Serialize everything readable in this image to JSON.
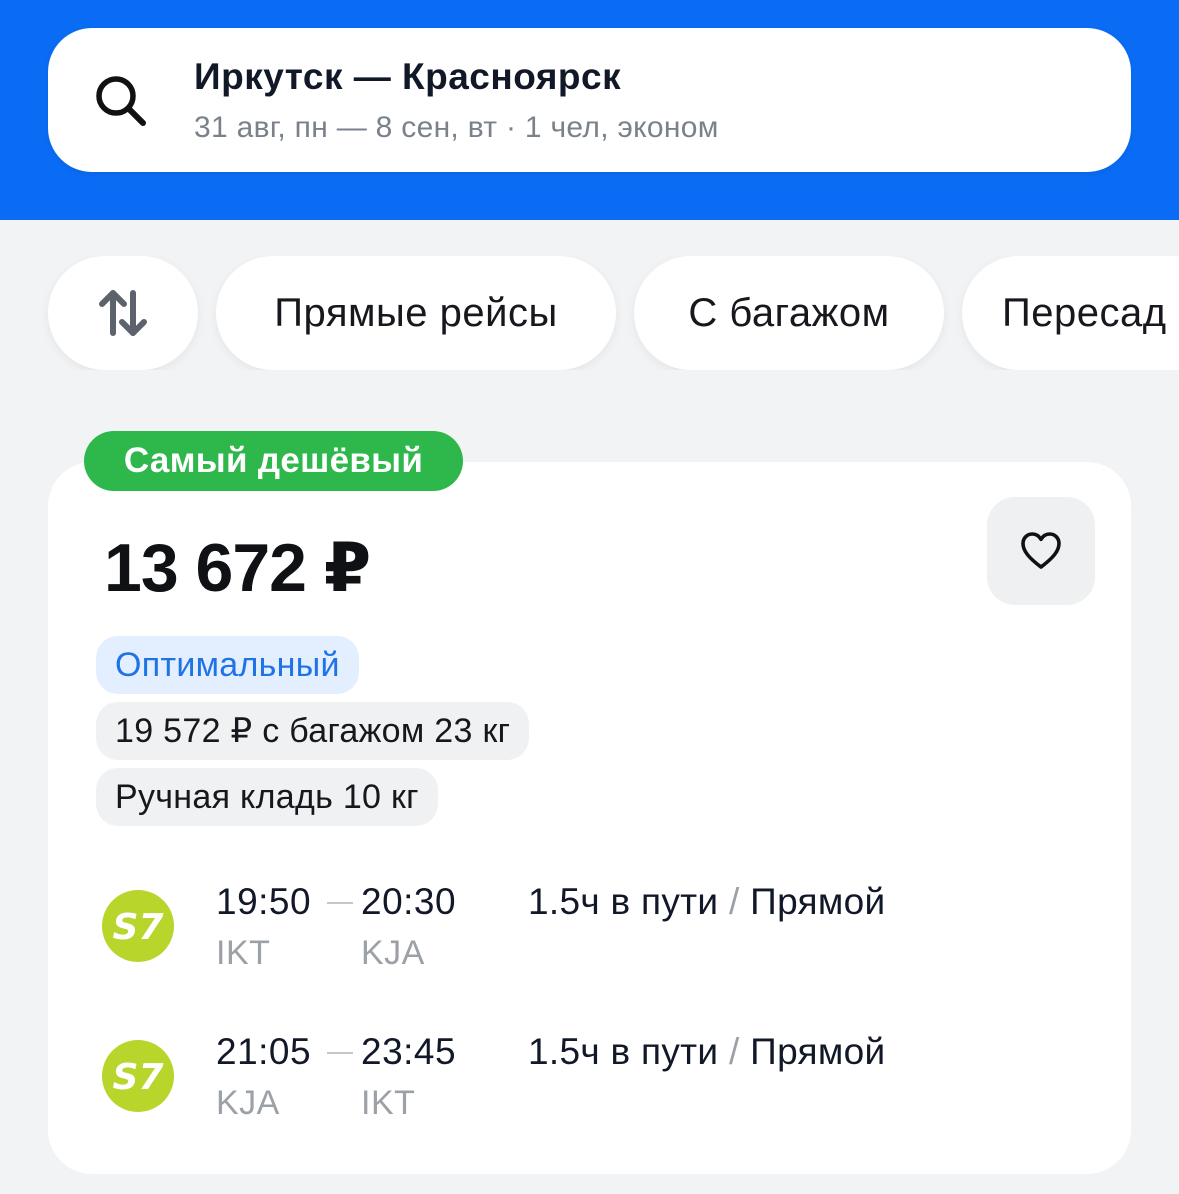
{
  "search": {
    "route": "Иркутск — Красноярск",
    "details": "31 авг, пн — 8 сен, вт · 1 чел, эконом"
  },
  "filters": {
    "sort_icon": "sort-arrows-icon",
    "chips": [
      "Прямые рейсы",
      "С багажом",
      "Пересад"
    ]
  },
  "offer": {
    "badge": "Самый дешёвый",
    "price": "13 672 ₽",
    "fare_tag": "Оптимальный",
    "baggage_option": "19 572 ₽ с багажом 23 кг",
    "hand_luggage": "Ручная кладь 10 кг",
    "favorite_icon": "heart-icon",
    "segments": [
      {
        "airline": "S7",
        "dep_time": "19:50",
        "arr_time": "20:30",
        "dep_code": "IKT",
        "arr_code": "KJA",
        "duration": "1.5ч в пути",
        "separator": "/",
        "type": "Прямой"
      },
      {
        "airline": "S7",
        "dep_time": "21:05",
        "arr_time": "23:45",
        "dep_code": "KJA",
        "arr_code": "IKT",
        "duration": "1.5ч в пути",
        "separator": "/",
        "type": "Прямой"
      }
    ]
  },
  "colors": {
    "brand_blue": "#0a6cf5",
    "badge_green": "#2eb84b",
    "airline_lime": "#b7d52a",
    "optimal_blue": "#1f73e6"
  }
}
